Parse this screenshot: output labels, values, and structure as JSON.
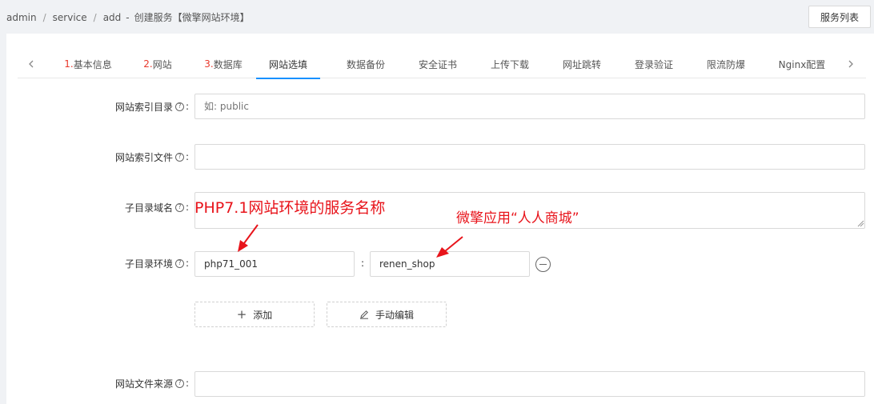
{
  "breadcrumb": {
    "items": [
      "admin",
      "service",
      "add"
    ],
    "page_title": "创建服务【微擎网站环境】"
  },
  "header": {
    "list_button": "服务列表"
  },
  "tabs": {
    "items": [
      {
        "num": "1.",
        "label": "基本信息"
      },
      {
        "num": "2.",
        "label": "网站"
      },
      {
        "num": "3.",
        "label": "数据库"
      },
      {
        "num": "",
        "label": "网站选填",
        "active": true
      },
      {
        "num": "",
        "label": "数据备份"
      },
      {
        "num": "",
        "label": "安全证书"
      },
      {
        "num": "",
        "label": "上传下载"
      },
      {
        "num": "",
        "label": "网址跳转"
      },
      {
        "num": "",
        "label": "登录验证"
      },
      {
        "num": "",
        "label": "限流防爆"
      },
      {
        "num": "",
        "label": "Nginx配置"
      }
    ],
    "prev_icon": "chevron-left-icon",
    "next_icon": "chevron-right-icon"
  },
  "form": {
    "index_dir": {
      "label": "网站索引目录",
      "value": "",
      "placeholder": "如: public"
    },
    "index_file": {
      "label": "网站索引文件",
      "value": ""
    },
    "subdir_domain": {
      "label": "子目录域名",
      "value": "",
      "placeholder": "PHP7.1网站环境的服务名称"
    },
    "subdir_env": {
      "label": "子目录环境",
      "key": "php71_001",
      "separator": ":",
      "value": "renen_shop"
    },
    "add_button": "添加",
    "manual_edit_button": "手动编辑",
    "source": {
      "label": "网站文件来源",
      "value": ""
    },
    "colon": ":",
    "help_glyph": "?"
  },
  "annotations": {
    "left_text": "PHP7.1网站环境的服务名称",
    "right_text": "微擎应用“人人商城”",
    "color": "#e8141b"
  },
  "colors": {
    "active_tab": "#1890ff",
    "step_number": "#e8382b"
  }
}
